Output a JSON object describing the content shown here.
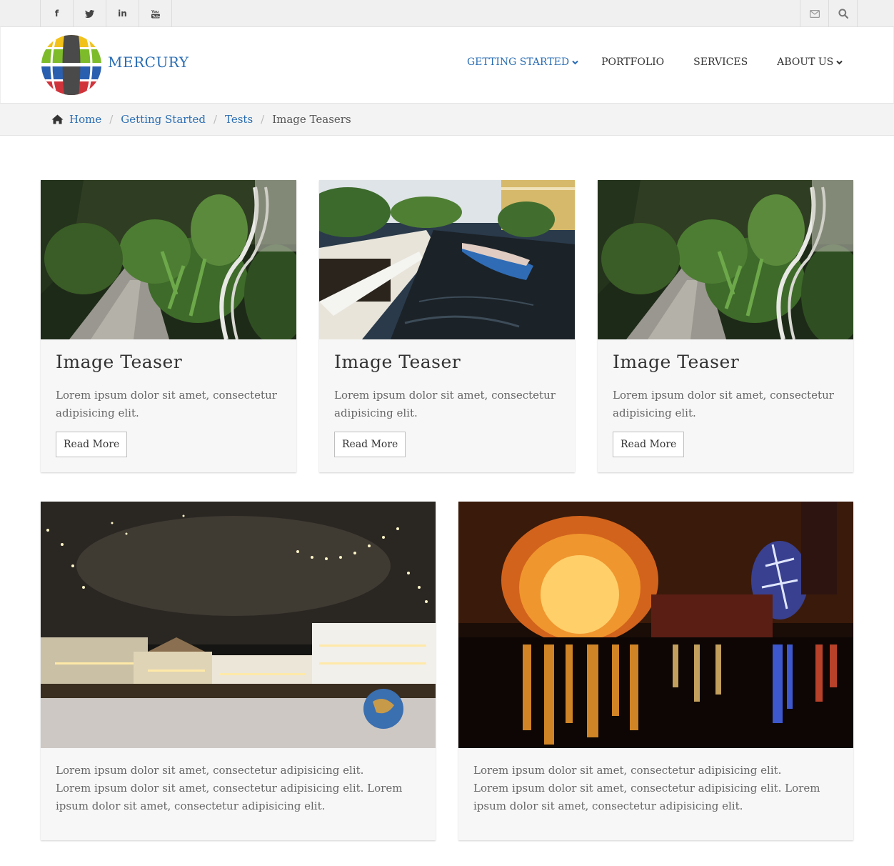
{
  "topbar": {
    "social": [
      {
        "icon": "facebook-icon",
        "glyph": "f"
      },
      {
        "icon": "twitter-icon",
        "glyph": "t"
      },
      {
        "icon": "linkedin-icon",
        "glyph": "in"
      },
      {
        "icon": "youtube-icon",
        "glyph": "You"
      }
    ],
    "right": [
      {
        "icon": "mail-icon"
      },
      {
        "icon": "search-icon"
      }
    ]
  },
  "header": {
    "brand": "MERCURY",
    "nav": [
      {
        "label": "GETTING STARTED",
        "active": true,
        "dropdown": true
      },
      {
        "label": "PORTFOLIO",
        "active": false,
        "dropdown": false
      },
      {
        "label": "SERVICES",
        "active": false,
        "dropdown": false
      },
      {
        "label": "ABOUT US",
        "active": false,
        "dropdown": true
      }
    ]
  },
  "breadcrumb": {
    "home": "Home",
    "items": [
      "Getting Started",
      "Tests"
    ],
    "current": "Image Teasers"
  },
  "teasers": [
    {
      "image": "garden-stairs-photo",
      "title": "Image Teaser",
      "text_line1": "Lorem ipsum dolor sit amet, consectetur",
      "text_line2": "adipisicing elit.",
      "button": "Read More"
    },
    {
      "image": "canal-boat-photo",
      "title": "Image Teaser",
      "text_line1": "Lorem ipsum dolor sit amet, consectetur",
      "text_line2": "adipisicing elit.",
      "button": "Read More"
    },
    {
      "image": "garden-stairs-photo",
      "title": "Image Teaser",
      "text_line1": "Lorem ipsum dolor sit amet, consectetur",
      "text_line2": "adipisicing elit.",
      "button": "Read More"
    }
  ],
  "wide_teasers": [
    {
      "image": "night-square-photo",
      "line1": "Lorem ipsum dolor sit amet, consectetur adipisicing elit.",
      "line2": "Lorem ipsum dolor sit amet, consectetur adipisicing elit. Lorem",
      "line3": "ipsum dolor sit amet, consectetur adipisicing elit."
    },
    {
      "image": "lights-lake-photo",
      "line1": "Lorem ipsum dolor sit amet, consectetur adipisicing elit.",
      "line2": "Lorem ipsum dolor sit amet, consectetur adipisicing elit. Lorem",
      "line3": "ipsum dolor sit amet, consectetur adipisicing elit."
    }
  ],
  "colors": {
    "accent": "#2a6db3",
    "card_bg": "#f7f7f7",
    "topbar_bg": "#f0f0f0"
  }
}
